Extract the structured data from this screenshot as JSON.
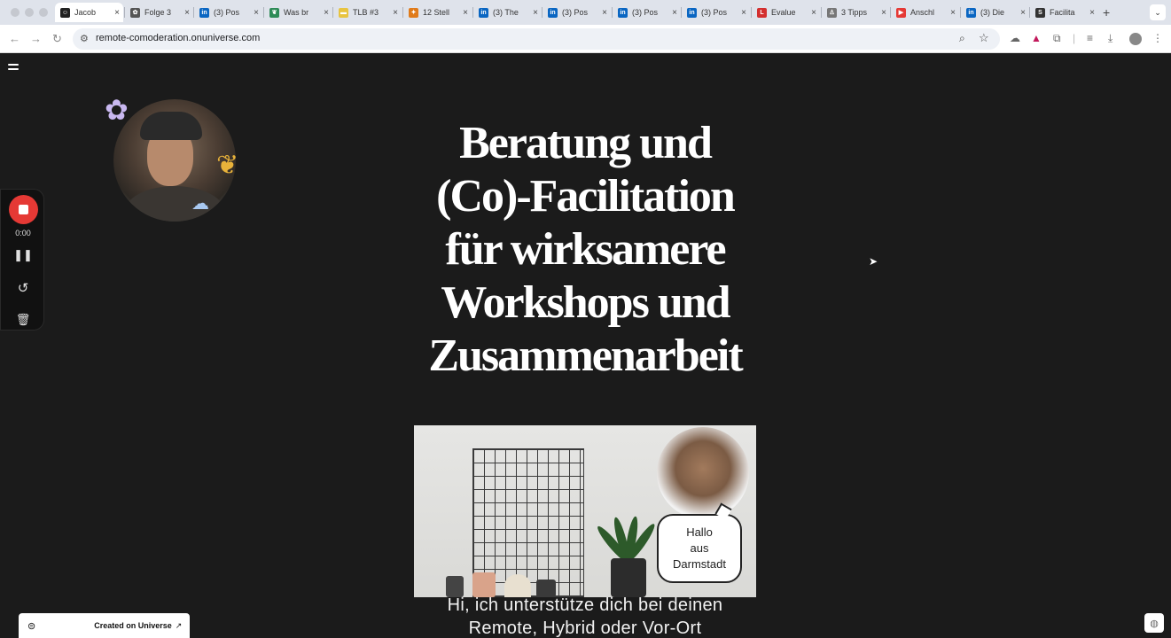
{
  "browser": {
    "tabs": [
      {
        "title": "Jacob ",
        "favicon": "smile-favicon",
        "color": "#222222",
        "active": true
      },
      {
        "title": "Folge 3",
        "favicon": "octopus-favicon",
        "color": "#555555"
      },
      {
        "title": "(3) Pos",
        "favicon": "linkedin-favicon",
        "color": "#0a66c2"
      },
      {
        "title": "Was br",
        "favicon": "leaf-favicon",
        "color": "#2e8b57"
      },
      {
        "title": "TLB #3",
        "favicon": "bar-favicon",
        "color": "#e8c440"
      },
      {
        "title": "12 Stell",
        "favicon": "flame-favicon",
        "color": "#e07b1a"
      },
      {
        "title": "(3) The",
        "favicon": "linkedin-favicon",
        "color": "#0a66c2"
      },
      {
        "title": "(3) Pos",
        "favicon": "linkedin-favicon",
        "color": "#0a66c2"
      },
      {
        "title": "(3) Pos",
        "favicon": "linkedin-favicon",
        "color": "#0a66c2"
      },
      {
        "title": "(3) Pos",
        "favicon": "linkedin-favicon",
        "color": "#0a66c2"
      },
      {
        "title": "Evalue",
        "favicon": "l-favicon",
        "color": "#d32f2f"
      },
      {
        "title": "3 Tipps",
        "favicon": "person-favicon",
        "color": "#777777"
      },
      {
        "title": "Anschl",
        "favicon": "youtube-favicon",
        "color": "#e53935"
      },
      {
        "title": "(3) Die",
        "favicon": "linkedin-favicon",
        "color": "#0a66c2"
      },
      {
        "title": "Facilita",
        "favicon": "s-favicon",
        "color": "#333333"
      }
    ],
    "tab_letters": [
      "☺",
      "✿",
      "in",
      "❦",
      "▬",
      "✦",
      "in",
      "in",
      "in",
      "in",
      "L",
      "♙",
      "▶",
      "in",
      "S"
    ],
    "url": "remote-comoderation.onuniverse.com"
  },
  "recorder": {
    "time": "0:00"
  },
  "page": {
    "headline": [
      "Beratung und",
      "(Co)-Facilitation",
      "für wirksamere",
      "Workshops und",
      "Zusammenarbeit"
    ],
    "video_bubble": [
      "Hallo",
      "aus",
      "Darmstadt"
    ],
    "subtitle": [
      "Hi, ich unterstütze dich bei deinen",
      "Remote, Hybrid oder Vor-Ort"
    ],
    "badge": "Created on Universe"
  }
}
